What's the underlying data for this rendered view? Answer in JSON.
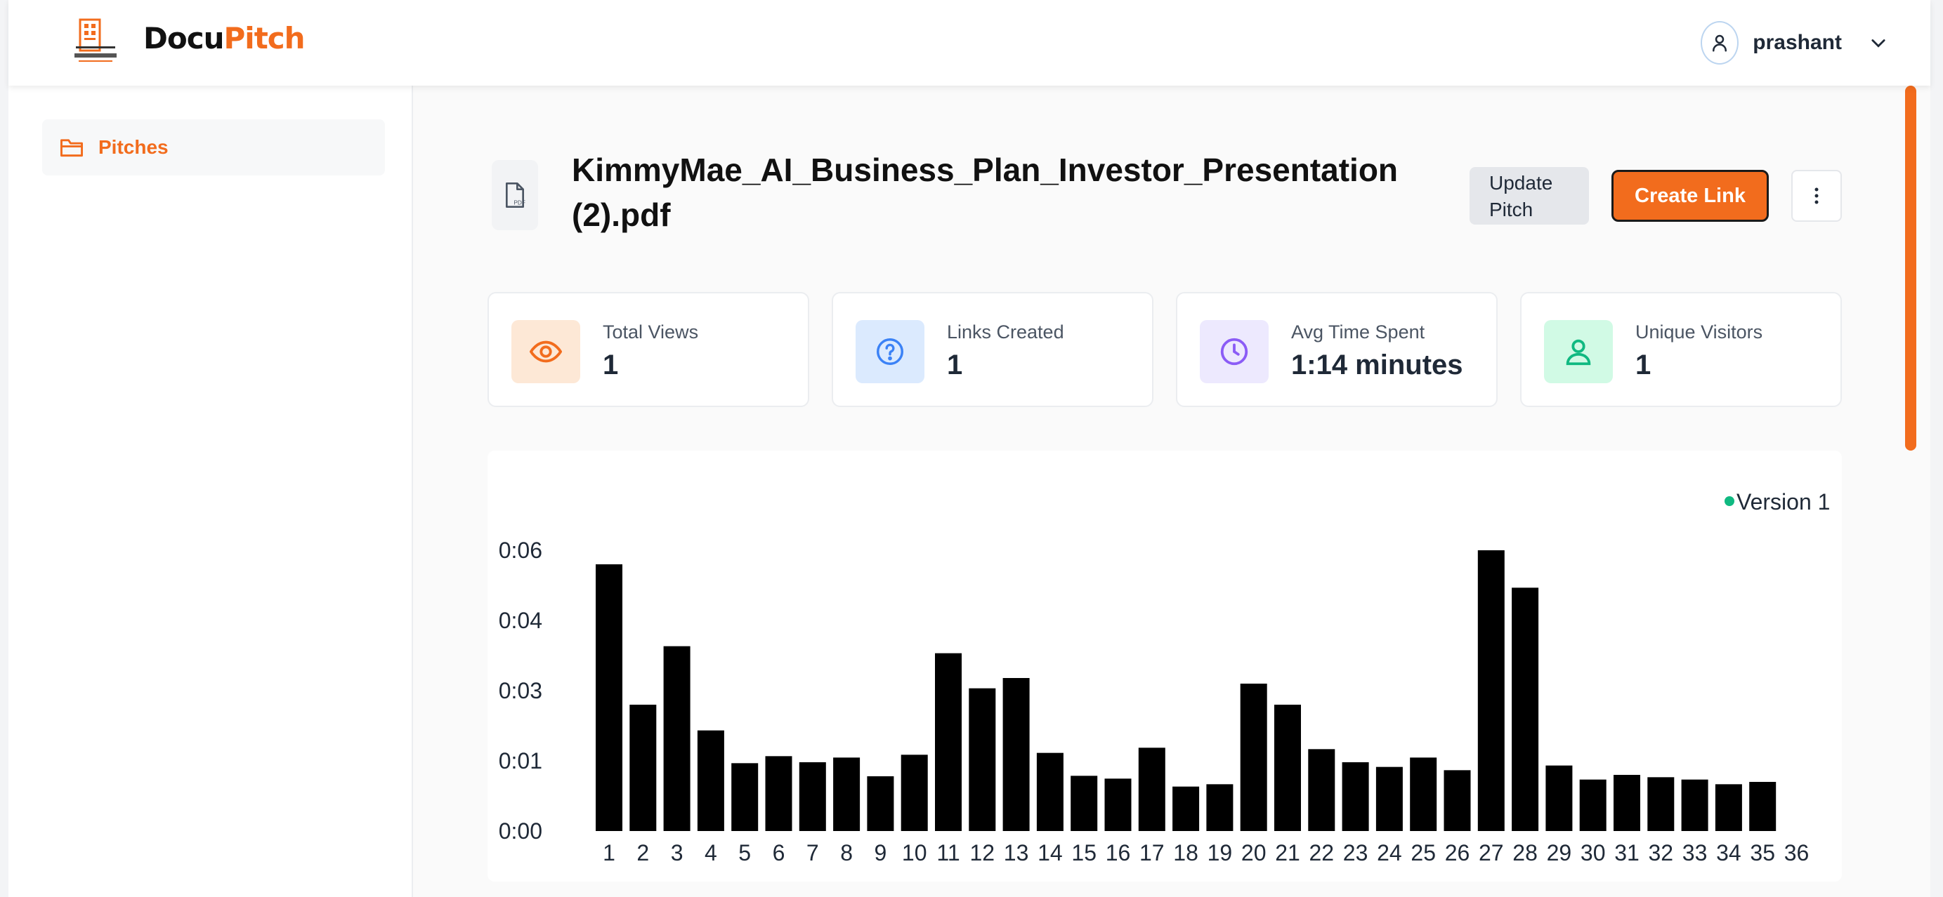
{
  "header": {
    "brand_part1": "Docu",
    "brand_part2": "Pitch",
    "username": "prashant",
    "icons": [
      "logo-icon",
      "user-icon",
      "chevron-down-icon"
    ]
  },
  "sidebar": {
    "items": [
      {
        "label": "Pitches",
        "icon": "folder-icon"
      }
    ]
  },
  "document": {
    "title": "KimmyMae_AI_Business_Plan_Investor_Presentation (2).pdf",
    "file_icon": "pdf-file-icon",
    "actions": {
      "update_label": "Update Pitch",
      "create_label": "Create Link",
      "more_icon": "more-vertical-icon"
    }
  },
  "stats": [
    {
      "label": "Total Views",
      "value": "1",
      "icon": "eye-icon",
      "color": "#f26c1d",
      "bg": "#fde8d6"
    },
    {
      "label": "Links Created",
      "value": "1",
      "icon": "help-circle-icon",
      "color": "#3b82f6",
      "bg": "#dbeafe"
    },
    {
      "label": "Avg Time Spent",
      "value": "1:14 minutes",
      "icon": "clock-icon",
      "color": "#8b5cf6",
      "bg": "#ede9fe"
    },
    {
      "label": "Unique Visitors",
      "value": "1",
      "icon": "user-icon",
      "color": "#10b981",
      "bg": "#d1fae5"
    }
  ],
  "colors": {
    "accent": "#f26c1d",
    "bar": "#000000",
    "legend_dot": "#10b981"
  },
  "chart_data": {
    "type": "bar",
    "categories": [
      "1",
      "2",
      "3",
      "4",
      "5",
      "6",
      "7",
      "8",
      "9",
      "10",
      "11",
      "12",
      "13",
      "14",
      "15",
      "16",
      "17",
      "18",
      "19",
      "20",
      "21",
      "22",
      "23",
      "24",
      "25",
      "26",
      "27",
      "28",
      "29",
      "30",
      "31",
      "32",
      "33",
      "34",
      "35",
      "36"
    ],
    "series": [
      {
        "name": "Version 1",
        "values": [
          5.7,
          2.7,
          3.95,
          2.15,
          1.45,
          1.6,
          1.47,
          1.57,
          1.17,
          1.63,
          3.8,
          3.05,
          3.27,
          1.67,
          1.18,
          1.12,
          1.78,
          0.95,
          1.0,
          3.15,
          2.7,
          1.75,
          1.47,
          1.37,
          1.57,
          1.3,
          6.0,
          5.2,
          1.4,
          1.1,
          1.2,
          1.15,
          1.1,
          1.0,
          1.05,
          0
        ]
      }
    ],
    "yticks": [
      {
        "value": 0,
        "label": "0:00"
      },
      {
        "value": 1.5,
        "label": "0:01"
      },
      {
        "value": 3,
        "label": "0:03"
      },
      {
        "value": 4.5,
        "label": "0:04"
      },
      {
        "value": 6,
        "label": "0:06"
      }
    ],
    "ylim": [
      0,
      6
    ],
    "legend": "top-right",
    "grid": false
  }
}
